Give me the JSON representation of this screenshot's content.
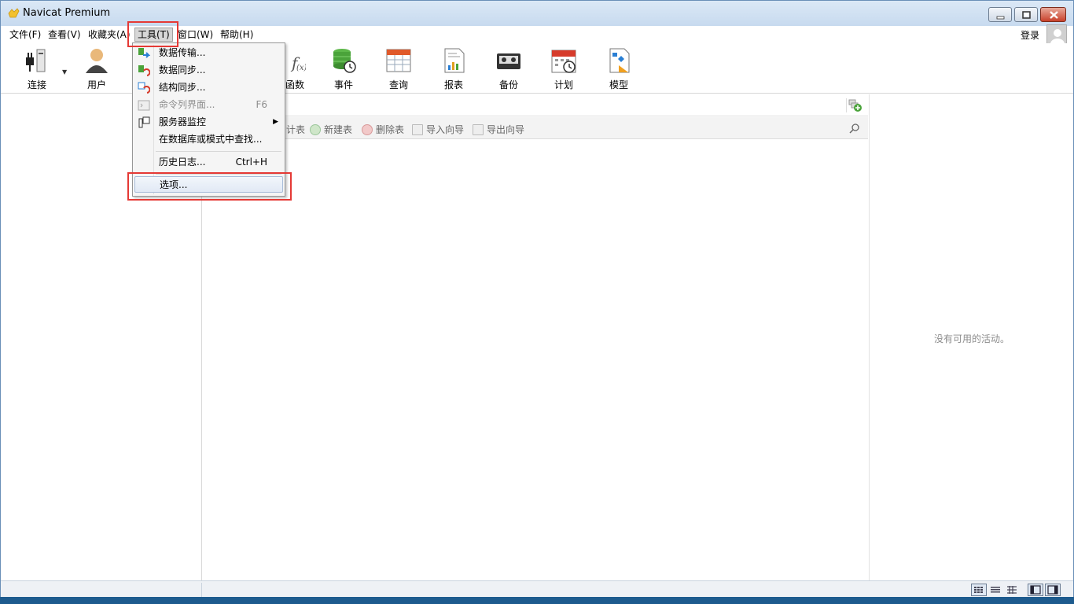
{
  "window": {
    "title": "Navicat Premium"
  },
  "menubar": {
    "items": [
      {
        "label": "文件(F)"
      },
      {
        "label": "查看(V)"
      },
      {
        "label": "收藏夹(A)"
      },
      {
        "label": "工具(T)"
      },
      {
        "label": "窗口(W)"
      },
      {
        "label": "帮助(H)"
      }
    ],
    "login_label": "登录"
  },
  "toolbar": {
    "items": [
      {
        "label": "连接",
        "icon": "connection-icon"
      },
      {
        "label": "用户",
        "icon": "user-icon"
      },
      {
        "label": "函数",
        "icon": "function-icon"
      },
      {
        "label": "事件",
        "icon": "event-icon"
      },
      {
        "label": "查询",
        "icon": "query-icon"
      },
      {
        "label": "报表",
        "icon": "report-icon"
      },
      {
        "label": "备份",
        "icon": "backup-icon"
      },
      {
        "label": "计划",
        "icon": "schedule-icon"
      },
      {
        "label": "模型",
        "icon": "model-icon"
      }
    ]
  },
  "tools_menu": {
    "items": [
      {
        "label": "数据传输...",
        "shortcut": "",
        "disabled": false
      },
      {
        "label": "数据同步...",
        "shortcut": "",
        "disabled": false
      },
      {
        "label": "结构同步...",
        "shortcut": "",
        "disabled": false
      },
      {
        "label": "命令列界面...",
        "shortcut": "F6",
        "disabled": true
      },
      {
        "label": "服务器监控",
        "shortcut": "",
        "disabled": false,
        "submenu": true
      },
      {
        "label": "在数据库或模式中查找...",
        "shortcut": "",
        "disabled": false
      },
      {
        "label": "历史日志...",
        "shortcut": "Ctrl+H",
        "disabled": false
      },
      {
        "label": "选项...",
        "shortcut": "",
        "disabled": false,
        "highlighted": true
      }
    ]
  },
  "object_bar": {
    "buttons": [
      {
        "label": "计表"
      },
      {
        "label": "新建表"
      },
      {
        "label": "删除表"
      },
      {
        "label": "导入向导"
      },
      {
        "label": "导出向导"
      }
    ]
  },
  "right_pane": {
    "empty_text": "没有可用的活动。"
  },
  "colors": {
    "highlight_box": "#e53935",
    "title_gradient": "#c7daef"
  }
}
